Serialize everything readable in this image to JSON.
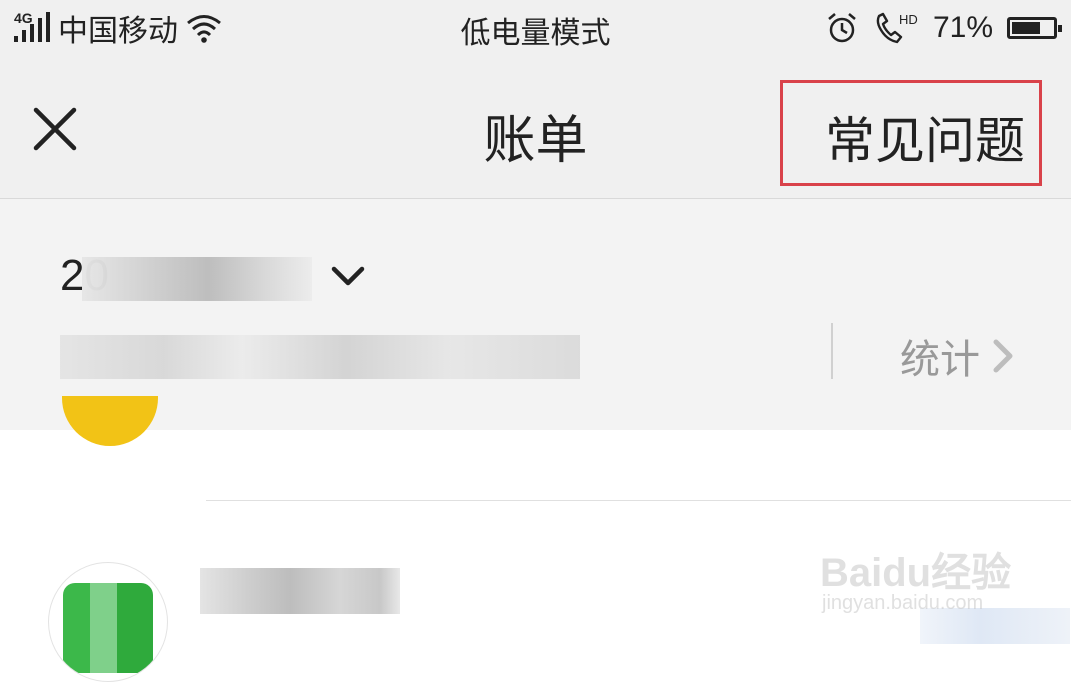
{
  "status_bar": {
    "network_type": "4G",
    "carrier": "中国移动",
    "mode": "低电量模式",
    "call_badge": "HD",
    "battery_percent": "71%",
    "battery_level": 0.71
  },
  "nav": {
    "title": "账单",
    "faq_label": "常见问题",
    "highlight_color": "#d9424a"
  },
  "filter": {
    "month_visible_prefix": "20",
    "stats_label": "统计"
  },
  "watermark": {
    "brand": "Baidu经验",
    "url": "jingyan.baidu.com"
  },
  "icons": [
    "signal-icon",
    "wifi-icon",
    "alarm-icon",
    "phone-hd-icon",
    "battery-icon",
    "close-icon",
    "chevron-down-icon",
    "chevron-right-icon"
  ]
}
